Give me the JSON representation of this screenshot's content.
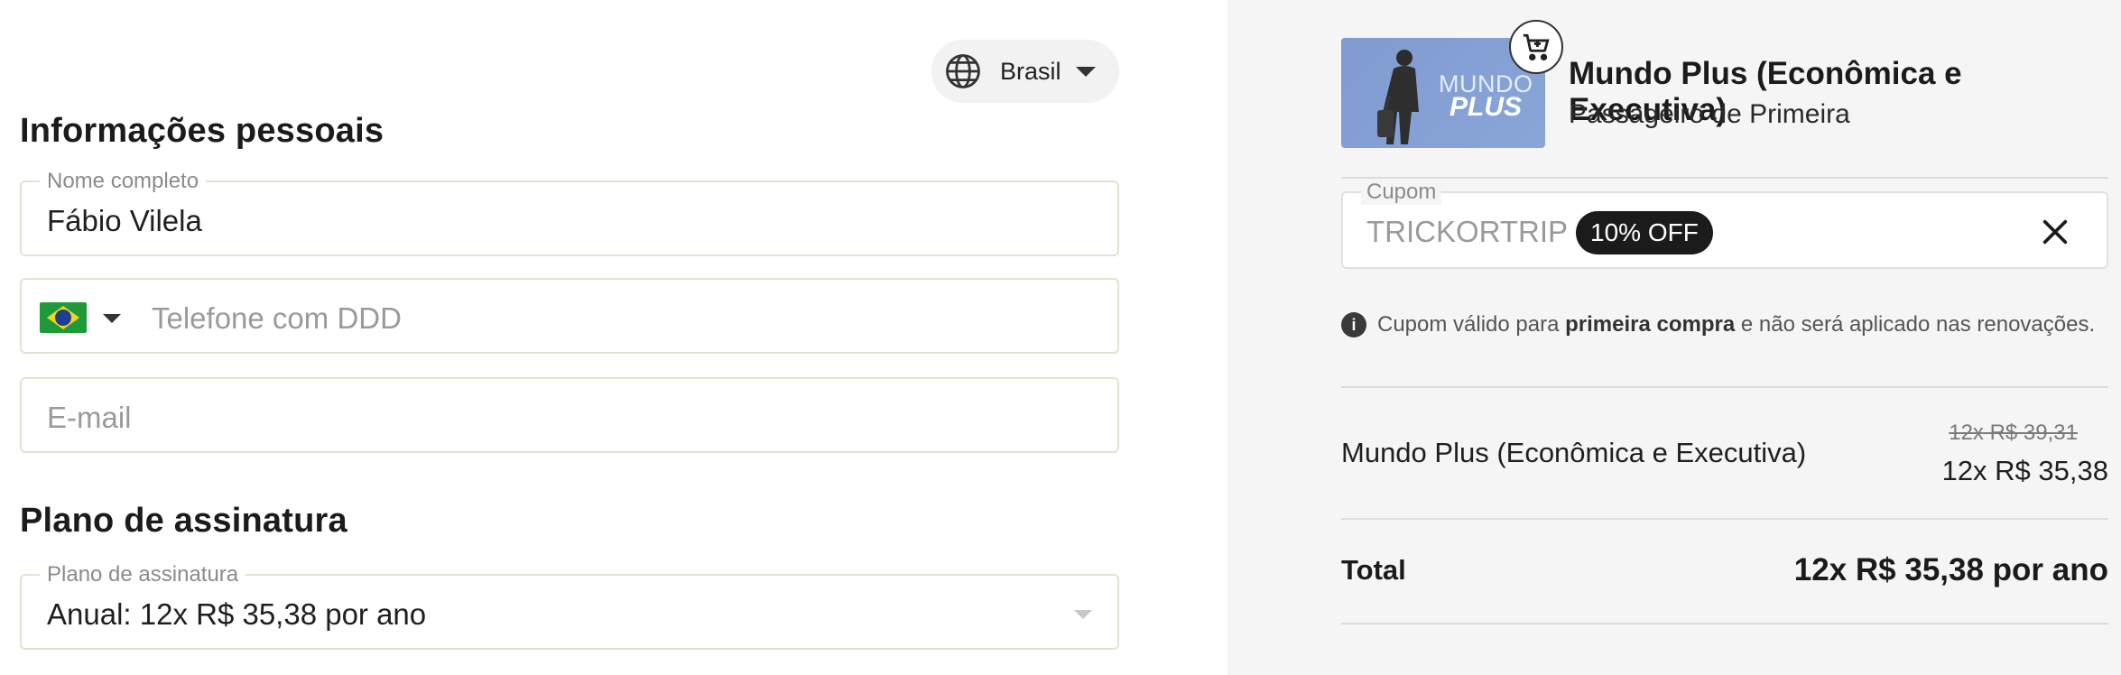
{
  "country_selector": {
    "label": "Brasil",
    "icon": "globe-icon"
  },
  "personal": {
    "title": "Informações pessoais",
    "name_field": {
      "legend": "Nome completo",
      "value": "Fábio Vilela"
    },
    "phone_field": {
      "placeholder": "Telefone com DDD",
      "flag": "brazil-flag-icon"
    },
    "email_field": {
      "placeholder": "E-mail"
    }
  },
  "subscription": {
    "title": "Plano de assinatura",
    "plan_field": {
      "legend": "Plano de assinatura",
      "value": "Anual: 12x R$ 35,38 por ano"
    }
  },
  "summary": {
    "product": {
      "image_text_1": "MUNDO",
      "image_text_2": "PLUS",
      "title": "Mundo Plus (Econômica e Executiva)",
      "subtitle": "Passageiro de Primeira"
    },
    "coupon": {
      "legend": "Cupom",
      "code": "TRICKORTRIP",
      "badge": "10% OFF",
      "note_prefix": "Cupom válido para ",
      "note_bold": "primeira compra",
      "note_suffix": " e não será aplicado nas renovações."
    },
    "line_item": {
      "label": "Mundo Plus (Econômica e Executiva)",
      "old_price": "12x R$ 39,31",
      "new_price": "12x R$ 35,38"
    },
    "total": {
      "label": "Total",
      "value": "12x R$ 35,38 por ano"
    }
  },
  "colors": {
    "right_panel_bg": "#f5f5f5",
    "badge_bg": "#1b1b1b",
    "field_border": "#e3e3cf"
  }
}
